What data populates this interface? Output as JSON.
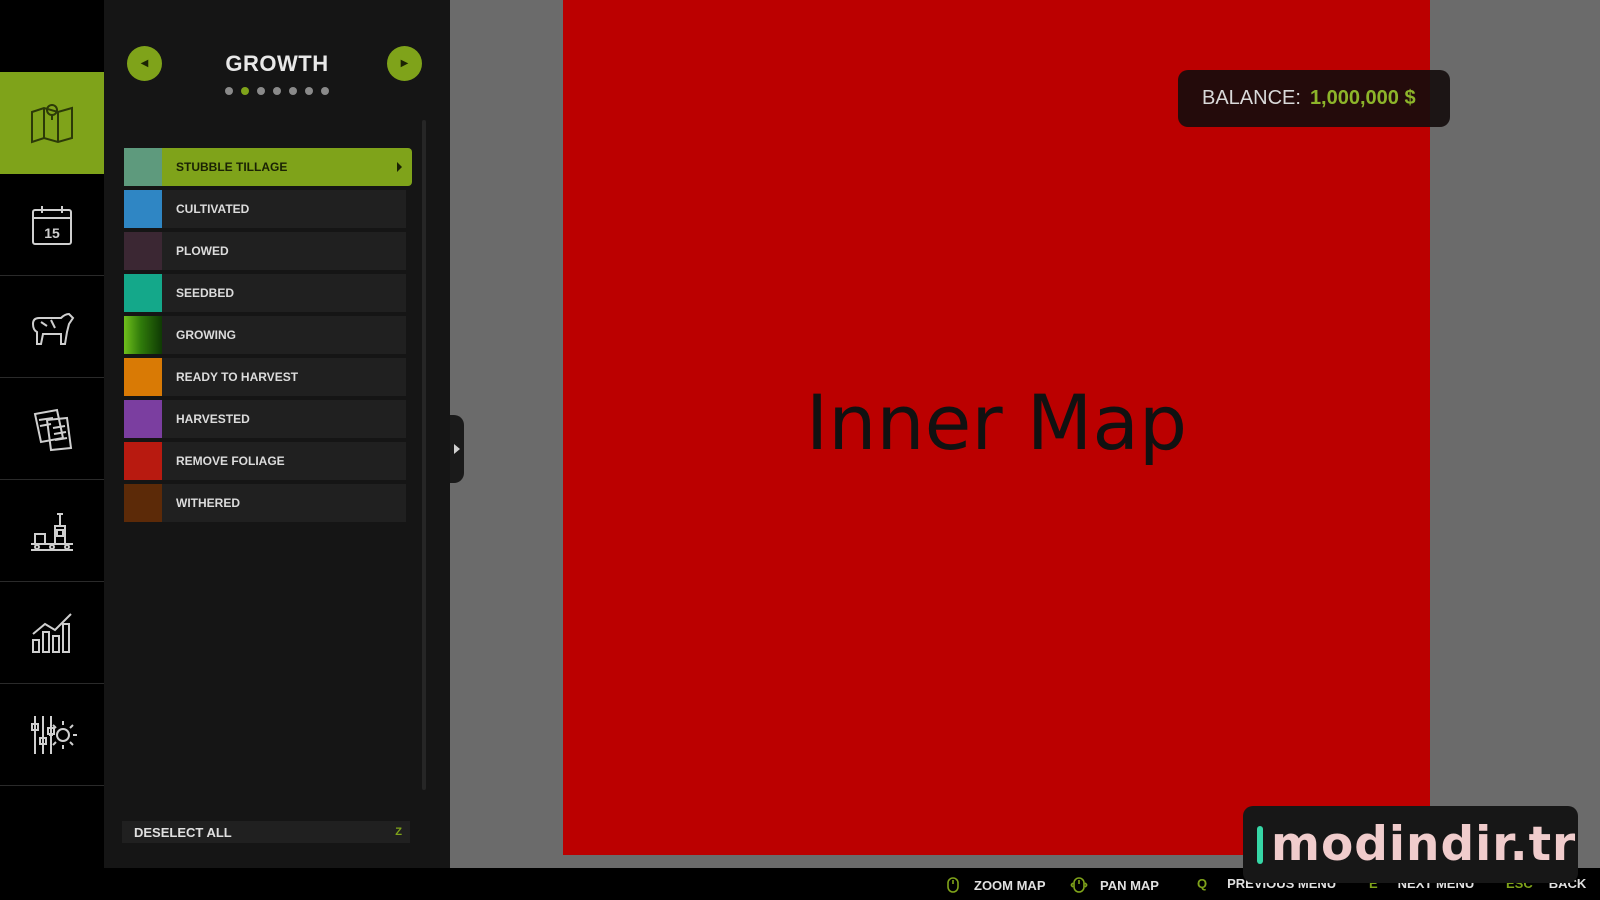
{
  "sidebar": {
    "items": [
      {
        "icon": "map-icon",
        "active": true
      },
      {
        "icon": "calendar-icon",
        "active": false,
        "calendar_day": "15"
      },
      {
        "icon": "cow-icon",
        "active": false
      },
      {
        "icon": "contracts-icon",
        "active": false
      },
      {
        "icon": "production-icon",
        "active": false
      },
      {
        "icon": "statistics-icon",
        "active": false
      },
      {
        "icon": "settings-icon",
        "active": false
      }
    ]
  },
  "panel": {
    "title": "GROWTH",
    "page_count": 7,
    "active_page": 2,
    "legend": [
      {
        "label": "STUBBLE TILLAGE",
        "color": "#5e9a7d",
        "selected": true
      },
      {
        "label": "CULTIVATED",
        "color": "#2f86c4",
        "selected": false
      },
      {
        "label": "PLOWED",
        "color": "#3b2733",
        "selected": false
      },
      {
        "label": "SEEDBED",
        "color": "#14a88a",
        "selected": false
      },
      {
        "label": "GROWING",
        "color": "#3f9a10",
        "selected": false
      },
      {
        "label": "READY TO HARVEST",
        "color": "#d97a05",
        "selected": false
      },
      {
        "label": "HARVESTED",
        "color": "#7b3ea0",
        "selected": false
      },
      {
        "label": "REMOVE FOLIAGE",
        "color": "#b81a10",
        "selected": false
      },
      {
        "label": "WITHERED",
        "color": "#5c2a08",
        "selected": false
      }
    ],
    "deselect_label": "DESELECT ALL",
    "deselect_key": "Z"
  },
  "map": {
    "inner_label": "Inner Map"
  },
  "balance": {
    "label": "BALANCE:",
    "value": "1,000,000 $"
  },
  "bottom_bar": {
    "zoom_label": "ZOOM MAP",
    "pan_label": "PAN MAP",
    "prev_key": "Q",
    "prev_label": "PREVIOUS MENU",
    "next_key": "E",
    "next_label": "NEXT MENU",
    "back_key": "ESC",
    "back_label": "BACK"
  },
  "watermark": {
    "text": "modindir.tr"
  },
  "colors": {
    "accent": "#7fa31a",
    "map_red": "#bb0000"
  }
}
